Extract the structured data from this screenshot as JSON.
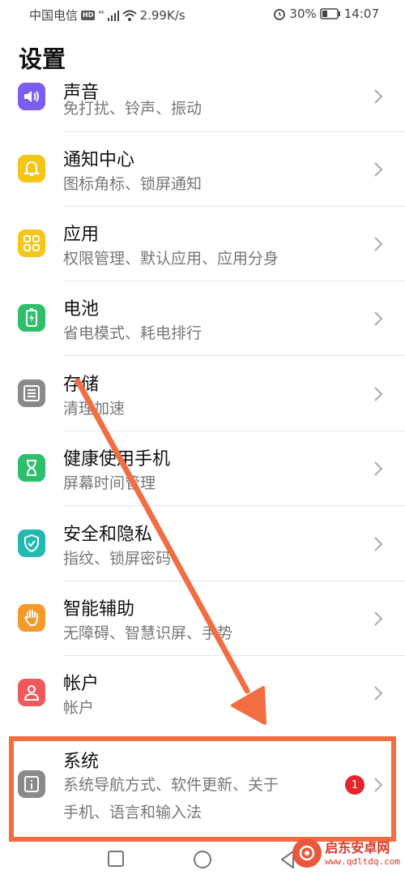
{
  "status_bar": {
    "carrier": "中国电信",
    "hd": "HD",
    "network": "⁴⁶",
    "speed": "2.99K/s",
    "battery": "30%",
    "time": "14:07"
  },
  "page": {
    "title": "设置"
  },
  "items": [
    {
      "title": "声音",
      "sub": "免打扰、铃声、振动",
      "icon": "sound-icon",
      "color": "#7b5ef0"
    },
    {
      "title": "通知中心",
      "sub": "图标角标、锁屏通知",
      "icon": "bell-icon",
      "color": "#f5c518"
    },
    {
      "title": "应用",
      "sub": "权限管理、默认应用、应用分身",
      "icon": "apps-icon",
      "color": "#f5c518"
    },
    {
      "title": "电池",
      "sub": "省电模式、耗电排行",
      "icon": "battery-icon",
      "color": "#2dbf6a"
    },
    {
      "title": "存储",
      "sub": "清理加速",
      "icon": "storage-icon",
      "color": "#8a8a8a"
    },
    {
      "title": "健康使用手机",
      "sub": "屏幕时间管理",
      "icon": "hourglass-icon",
      "color": "#2dbf6a"
    },
    {
      "title": "安全和隐私",
      "sub": "指纹、锁屏密码",
      "icon": "shield-icon",
      "color": "#22b9b0"
    },
    {
      "title": "智能辅助",
      "sub": "无障碍、智慧识屏、手势",
      "icon": "hand-icon",
      "color": "#f39a2b"
    },
    {
      "title": "帐户",
      "sub": "帐户",
      "icon": "person-icon",
      "color": "#ee5a5a"
    },
    {
      "title": "系统",
      "sub_line1": "系统导航方式、软件更新、关于",
      "sub_line2": "手机、语言和输入法",
      "icon": "info-icon",
      "color": "#8a8a8a",
      "badge": "1"
    }
  ],
  "watermark": {
    "name": "启东安卓网",
    "url": "www.qdltdq.com"
  }
}
